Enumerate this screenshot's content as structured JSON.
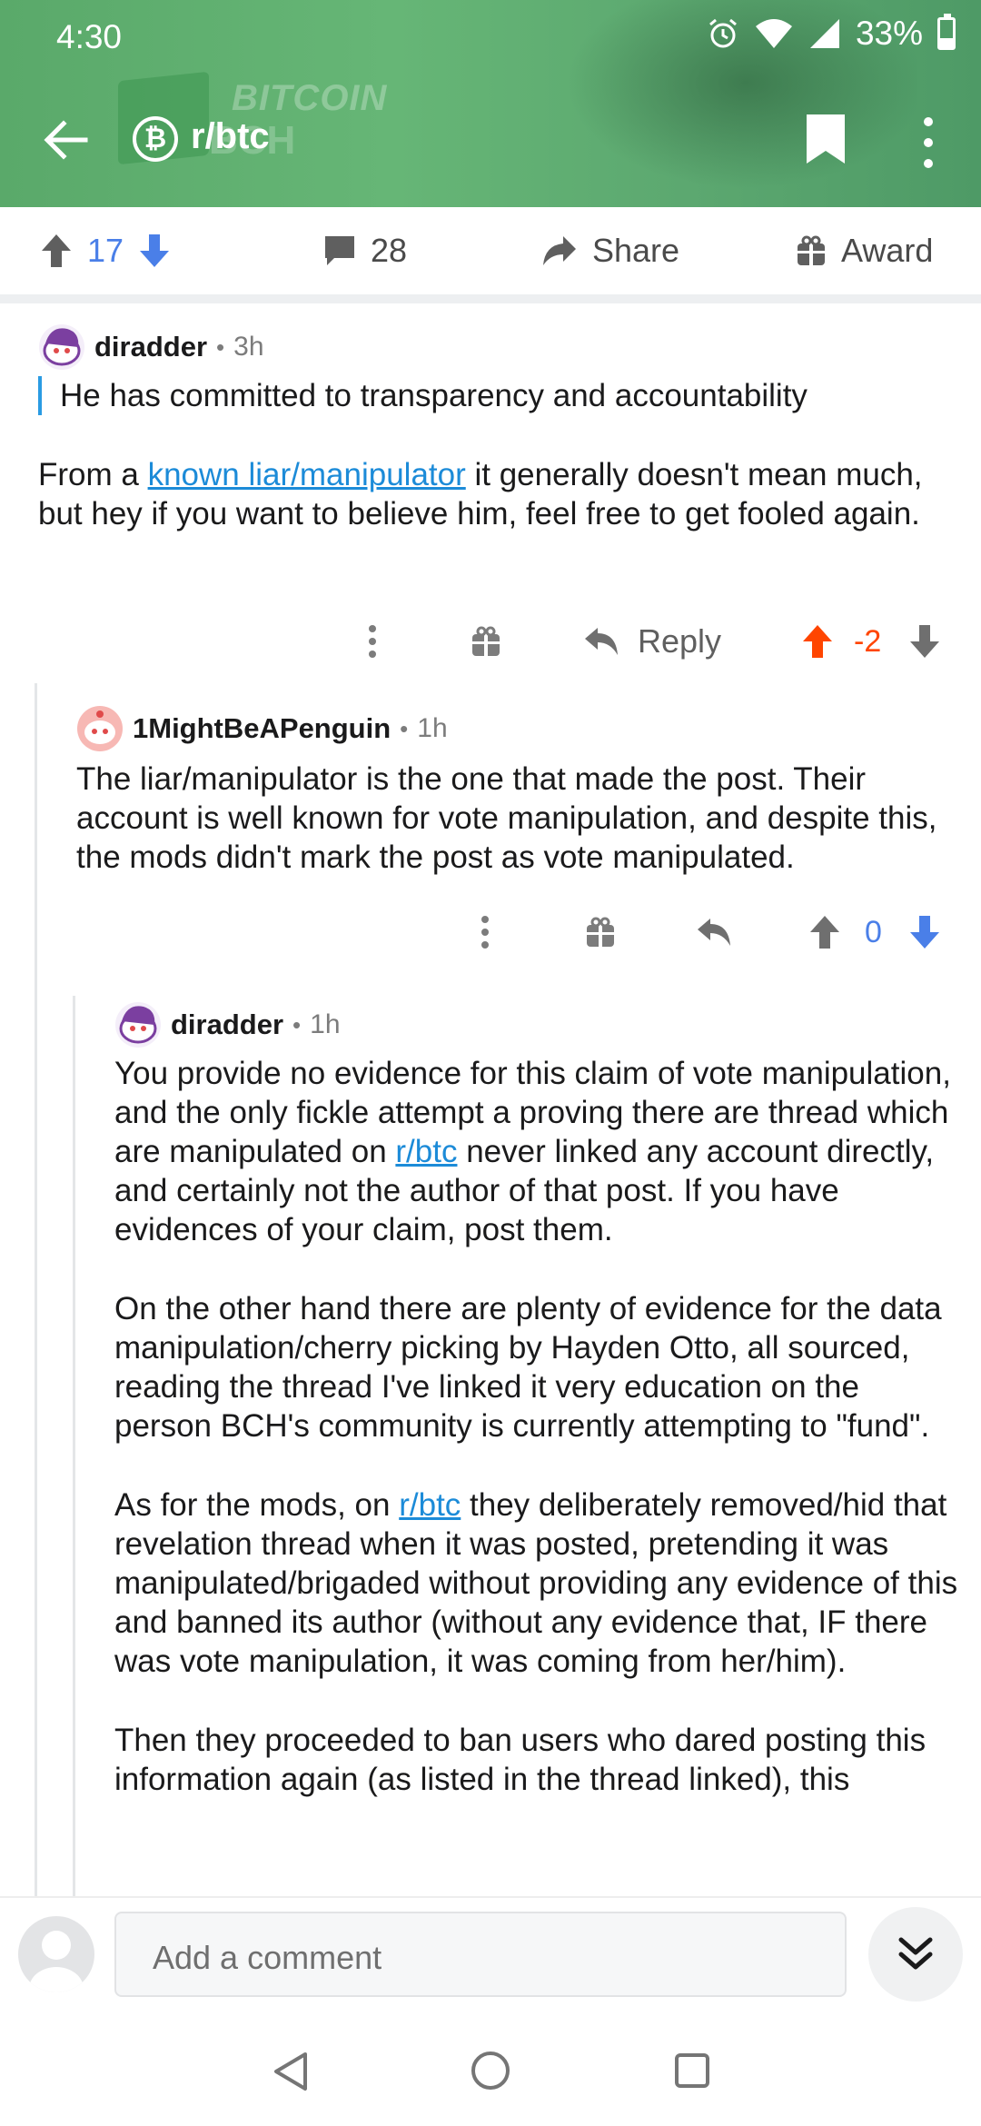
{
  "status_bar": {
    "time": "4:30",
    "battery": "33%"
  },
  "header": {
    "subreddit": "r/btc",
    "banner_watermark": "BITCOIN",
    "banner_watermark2": "BCH",
    "icons": [
      "back-arrow-icon",
      "bitcoin-icon",
      "bookmark-icon",
      "more-vert-icon"
    ]
  },
  "post_actions": {
    "score": "17",
    "comments": "28",
    "share_label": "Share",
    "award_label": "Award"
  },
  "comments": [
    {
      "author": "diradder",
      "age": "3h",
      "quote": "He has committed to transparency and accountability",
      "text_before_link": "From a ",
      "link_text": "known liar/manipulator",
      "text_after_link": " it generally doesn't mean much, but hey if you want to believe him, feel free to get fooled again.",
      "reply_label": "Reply",
      "score": "-2"
    },
    {
      "author": "1MightBeAPenguin",
      "age": "1h",
      "text": "The liar/manipulator is the one that made the post. Their account is well known for vote manipulation, and despite this, the mods didn't mark the post as vote manipulated.",
      "score": "0"
    },
    {
      "author": "diradder",
      "age": "1h",
      "p1_before": "You provide no evidence for this claim of vote manipulation, and the only fickle attempt a proving there are thread which are manipulated on ",
      "p1_link": "r/btc",
      "p1_after": " never linked any account directly, and certainly not the author of that post. If you have evidences of your claim, post them.",
      "p2": "On the other hand there are plenty of evidence for the data manipulation/cherry picking by Hayden Otto, all sourced, reading the thread I've linked it very education on the person BCH's community is currently attempting to \"fund\".",
      "p3_before": "As for the mods, on ",
      "p3_link": "r/btc",
      "p3_after": " they deliberately removed/hid that revelation thread when it was posted, pretending it was manipulated/brigaded without providing any evidence of this and banned its author (without any evidence that, IF there was vote manipulation, it was coming from her/him).",
      "p4": "Then they proceeded to ban users who dared posting this information again (as listed in the thread linked), this"
    }
  ],
  "comment_bar": {
    "placeholder": "Add a comment"
  },
  "colors": {
    "header_green": "#5fae6f",
    "upvote_orange": "#ff4500",
    "blue": "#4a7fe8",
    "link": "#1c8bd8"
  }
}
